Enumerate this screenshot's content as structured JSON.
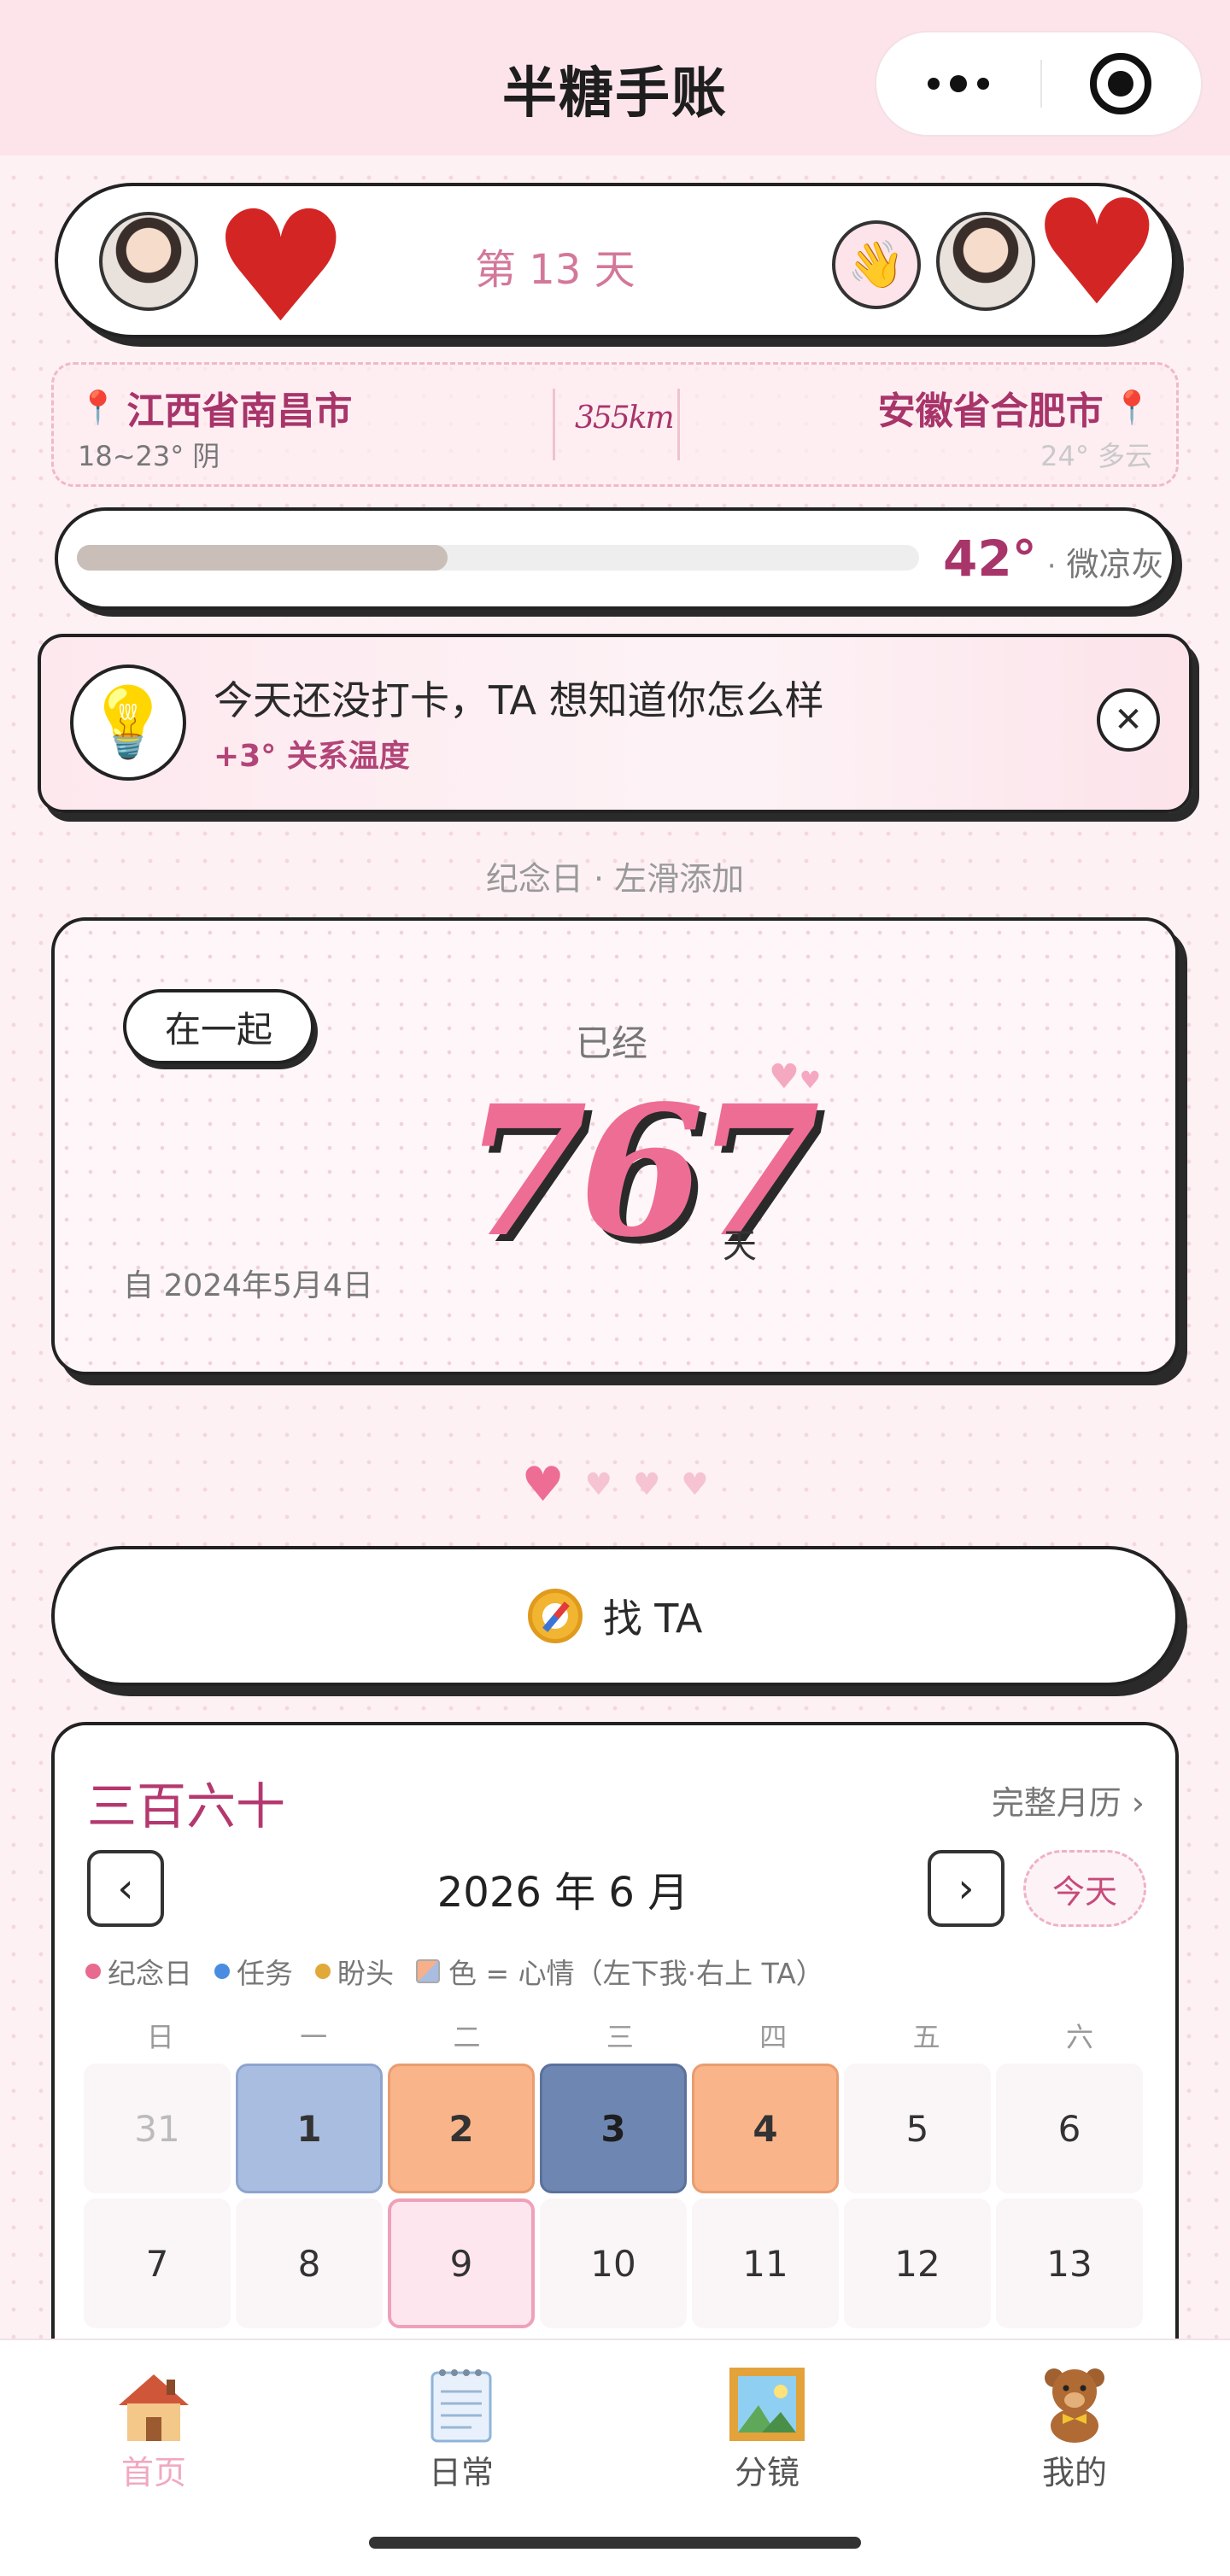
{
  "app": {
    "title": "半糖手账"
  },
  "couple": {
    "day_label": "第 13 天",
    "wave_emoji": "👋"
  },
  "locations": {
    "left": {
      "name": "江西省南昌市",
      "weather": "18~23° 阴"
    },
    "distance": "355km",
    "right": {
      "name": "安徽省合肥市",
      "weather": "24° 多云"
    }
  },
  "temperature": {
    "value": "42°",
    "sep": "·",
    "label": "微凉灰",
    "fill_fraction": 0.44
  },
  "tip": {
    "title": "今天还没打卡，TA 想知道你怎么样",
    "subtitle": "+3° 关系温度",
    "close": "✕"
  },
  "anniversary": {
    "hint": "纪念日 · 左滑添加",
    "tag": "在一起",
    "already": "已经",
    "days": "767",
    "unit": "天",
    "since": "自 2024年5月4日"
  },
  "find_button": {
    "label": "找 TA"
  },
  "calendar": {
    "title": "三百六十",
    "full_link": "完整月历 ›",
    "prev": "‹",
    "next": "›",
    "month": "2026 年 6 月",
    "today": "今天",
    "legend": [
      {
        "label": "纪念日",
        "color": "#e86a8e"
      },
      {
        "label": "任务",
        "color": "#4a8de0"
      },
      {
        "label": "盼头",
        "color": "#e0a93a"
      }
    ],
    "legend_mood": "色 = 心情（左下我·右上 TA）",
    "weekdays": [
      "日",
      "一",
      "二",
      "三",
      "四",
      "五",
      "六"
    ],
    "row1": [
      "31",
      "1",
      "2",
      "3",
      "4",
      "5",
      "6"
    ],
    "row2": [
      "7",
      "8",
      "9",
      "10",
      "11",
      "12",
      "13"
    ],
    "colors": {
      "light_blue": "#a9bde0",
      "peach": "#f9b48a",
      "slate": "#6e86b2",
      "today_border": "#eea1b8"
    }
  },
  "tabs": [
    {
      "label": "首页",
      "icon": "house-icon"
    },
    {
      "label": "日常",
      "icon": "notepad-icon"
    },
    {
      "label": "分镜",
      "icon": "framed-picture-icon"
    },
    {
      "label": "我的",
      "icon": "teddy-bear-icon"
    }
  ]
}
